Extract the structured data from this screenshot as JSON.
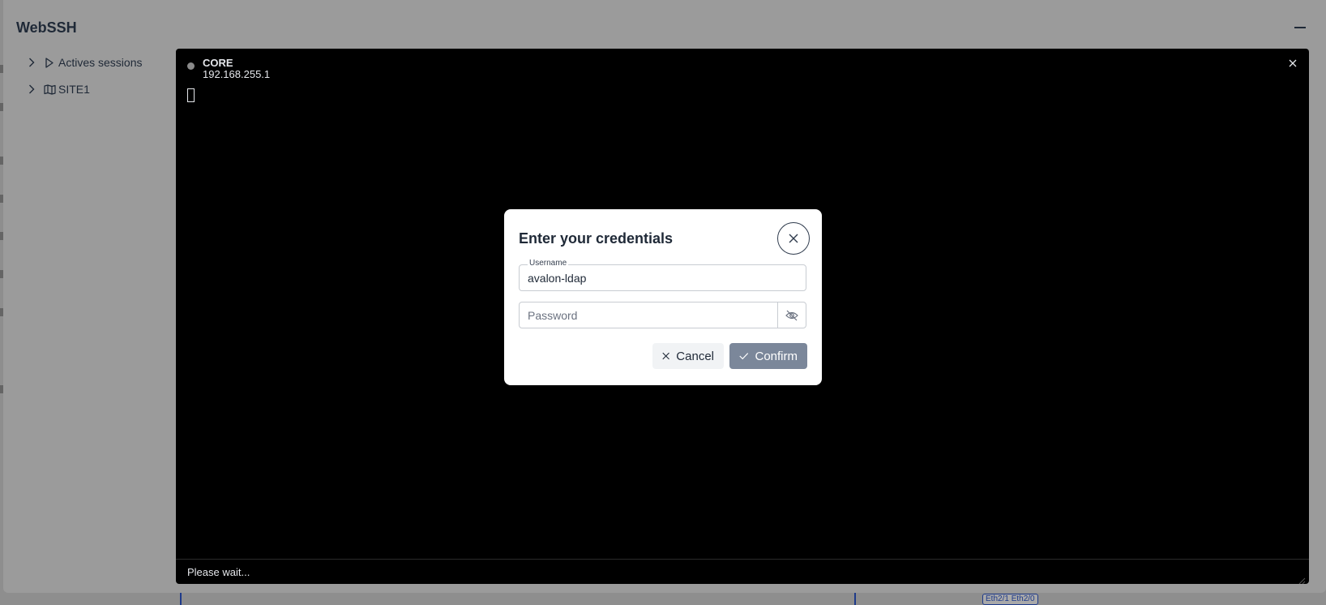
{
  "app": {
    "title": "WebSSH"
  },
  "tree": {
    "items": [
      {
        "label": "Actives sessions",
        "icon": "play-outline-icon"
      },
      {
        "label": "SITE1",
        "icon": "map-icon"
      }
    ]
  },
  "terminal": {
    "host_name": "CORE",
    "host_ip": "192.168.255.1",
    "status": "Please wait..."
  },
  "modal": {
    "title": "Enter your credentials",
    "username_label": "Username",
    "username_value": "avalon-ldap",
    "password_placeholder": "Password",
    "cancel_label": "Cancel",
    "confirm_label": "Confirm"
  },
  "background": {
    "port_label": "Eth2/1 Eth2/0"
  },
  "colors": {
    "overlay": "#9b9b9b",
    "terminal_bg": "#000000",
    "confirm_bg": "#7b879a",
    "cancel_bg": "#f1f3f5",
    "link_blue": "#1e3a8a"
  }
}
